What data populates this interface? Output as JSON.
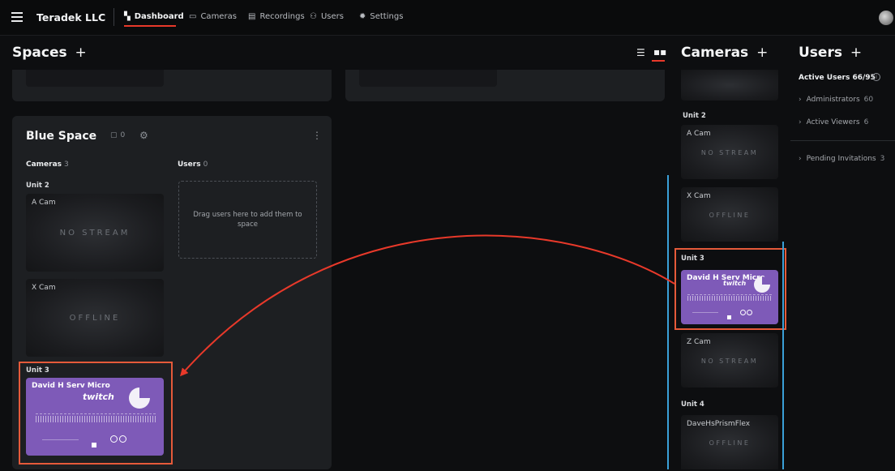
{
  "nav": {
    "brand": "Teradek LLC",
    "items": [
      {
        "label": "Dashboard",
        "icon": "dashboard-icon"
      },
      {
        "label": "Cameras",
        "icon": "cameras-icon"
      },
      {
        "label": "Recordings",
        "icon": "recordings-icon"
      },
      {
        "label": "Users",
        "icon": "users-icon"
      },
      {
        "label": "Settings",
        "icon": "gear-icon"
      }
    ],
    "active": "Dashboard"
  },
  "spaces": {
    "title": "Spaces",
    "add": "+"
  },
  "blue_space": {
    "name": "Blue Space",
    "camera_count": "0",
    "cameras_label": "Cameras",
    "cameras_num": "3",
    "users_label": "Users",
    "users_num": "0",
    "drop_text": "Drag users here to add them to space",
    "unit2": "Unit 2",
    "unit3": "Unit 3",
    "tiles": [
      {
        "name": "A Cam",
        "status": "NO STREAM"
      },
      {
        "name": "X Cam",
        "status": "OFFLINE"
      }
    ],
    "live": {
      "name": "David H Serv Micro",
      "brand": "twitch"
    }
  },
  "cameras_col": {
    "title": "Cameras",
    "add": "+",
    "units": [
      {
        "label": "Unit 2"
      },
      {
        "label": "Unit 3"
      },
      {
        "label": "Unit 4"
      }
    ],
    "tiles": [
      {
        "name": "A Cam",
        "status": "NO STREAM"
      },
      {
        "name": "X Cam",
        "status": "OFFLINE"
      },
      {
        "name": "David H Serv Micro",
        "status": "twitch"
      },
      {
        "name": "Z Cam",
        "status": "NO STREAM"
      },
      {
        "name": "DaveHsPrismFlex",
        "status": "OFFLINE"
      }
    ]
  },
  "users_col": {
    "title": "Users",
    "add": "+",
    "active": "Active Users 66/95",
    "rows": [
      {
        "label": "Administrators",
        "count": "60"
      },
      {
        "label": "Active Viewers",
        "count": "6"
      },
      {
        "label": "Pending Invitations",
        "count": "3"
      }
    ]
  },
  "colors": {
    "accent": "#e8392a",
    "highlight": "#e55a3a",
    "drag_line": "#3aa0d8",
    "live_tile": "#7e5ab8"
  }
}
